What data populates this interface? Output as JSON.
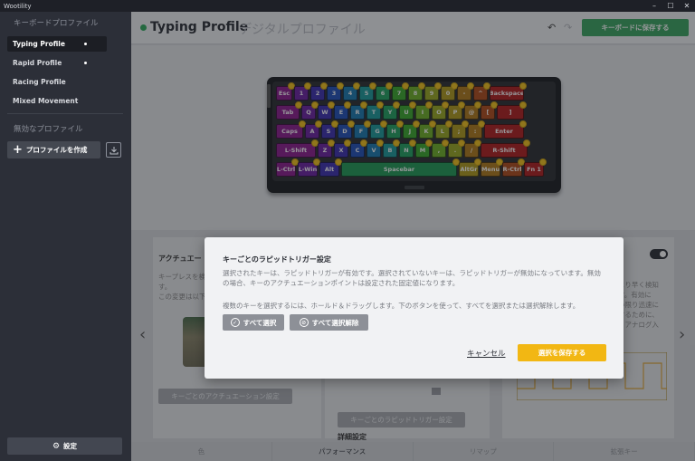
{
  "app": {
    "title": "Wootility"
  },
  "window_controls": {
    "minimize": "–",
    "maximize": "☐",
    "close": "✕"
  },
  "sidebar": {
    "heading_keyboard": "キーボードプロファイル",
    "items": [
      {
        "label": "Typing Profile",
        "active": true
      },
      {
        "label": "Rapid Profile",
        "active": false
      },
      {
        "label": "Racing Profile",
        "active": false
      },
      {
        "label": "Mixed Movement",
        "active": false
      }
    ],
    "heading_disabled": "無効なプロファイル",
    "create_label": "プロファイルを作成",
    "settings_label": "設定"
  },
  "header": {
    "title": "Typing Profile",
    "subtitle": "デジタルプロファイル",
    "save_label": "キーボードに保存する"
  },
  "keyboard": {
    "rows": [
      [
        {
          "label": "Esc",
          "w": 18,
          "c": "#8b1a8c"
        },
        {
          "label": "1",
          "w": 16,
          "c": "#6a1fa0"
        },
        {
          "label": "2",
          "w": 16,
          "c": "#3b2fb0"
        },
        {
          "label": "3",
          "w": 16,
          "c": "#1f4fb8"
        },
        {
          "label": "4",
          "w": 16,
          "c": "#1878b0"
        },
        {
          "label": "5",
          "w": 16,
          "c": "#1a9a9a"
        },
        {
          "label": "6",
          "w": 16,
          "c": "#1fa060"
        },
        {
          "label": "7",
          "w": 16,
          "c": "#3aa82a"
        },
        {
          "label": "8",
          "w": 16,
          "c": "#6db025"
        },
        {
          "label": "9",
          "w": 16,
          "c": "#9aa81f"
        },
        {
          "label": "0",
          "w": 16,
          "c": "#b09a1a"
        },
        {
          "label": "-",
          "w": 16,
          "c": "#b07818"
        },
        {
          "label": "^",
          "w": 16,
          "c": "#b04a18"
        },
        {
          "label": "Backspace",
          "w": 38,
          "c": "#b01c1c"
        }
      ],
      [
        {
          "label": "Tab",
          "w": 26,
          "c": "#8b1a8c"
        },
        {
          "label": "Q",
          "w": 16,
          "c": "#6a1fa0"
        },
        {
          "label": "W",
          "w": 16,
          "c": "#3b2fb0"
        },
        {
          "label": "E",
          "w": 16,
          "c": "#1f4fb8"
        },
        {
          "label": "R",
          "w": 16,
          "c": "#1878b0"
        },
        {
          "label": "T",
          "w": 16,
          "c": "#1a9a9a"
        },
        {
          "label": "Y",
          "w": 16,
          "c": "#1fa060"
        },
        {
          "label": "U",
          "w": 16,
          "c": "#3aa82a"
        },
        {
          "label": "I",
          "w": 16,
          "c": "#6db025"
        },
        {
          "label": "O",
          "w": 16,
          "c": "#9aa81f"
        },
        {
          "label": "P",
          "w": 16,
          "c": "#b09a1a"
        },
        {
          "label": "@",
          "w": 16,
          "c": "#b07818"
        },
        {
          "label": "[",
          "w": 16,
          "c": "#b04a18"
        },
        {
          "label": "]",
          "w": 30,
          "c": "#b01c1c"
        }
      ],
      [
        {
          "label": "Caps",
          "w": 30,
          "c": "#8b1a8c"
        },
        {
          "label": "A",
          "w": 16,
          "c": "#6a1fa0"
        },
        {
          "label": "S",
          "w": 16,
          "c": "#3b2fb0"
        },
        {
          "label": "D",
          "w": 16,
          "c": "#1f4fb8"
        },
        {
          "label": "F",
          "w": 16,
          "c": "#1878b0"
        },
        {
          "label": "G",
          "w": 16,
          "c": "#1a9a9a"
        },
        {
          "label": "H",
          "w": 16,
          "c": "#1fa060"
        },
        {
          "label": "J",
          "w": 16,
          "c": "#3aa82a"
        },
        {
          "label": "K",
          "w": 16,
          "c": "#6db025"
        },
        {
          "label": "L",
          "w": 16,
          "c": "#9aa81f"
        },
        {
          "label": ";",
          "w": 16,
          "c": "#b09a1a"
        },
        {
          "label": ":",
          "w": 16,
          "c": "#b07818"
        },
        {
          "label": "Enter",
          "w": 44,
          "c": "#b01c1c"
        }
      ],
      [
        {
          "label": "L-Shift",
          "w": 44,
          "c": "#8b1a8c"
        },
        {
          "label": "Z",
          "w": 16,
          "c": "#6a1fa0"
        },
        {
          "label": "X",
          "w": 16,
          "c": "#3b2fb0"
        },
        {
          "label": "C",
          "w": 16,
          "c": "#1f4fb8"
        },
        {
          "label": "V",
          "w": 16,
          "c": "#1878b0"
        },
        {
          "label": "B",
          "w": 16,
          "c": "#1a9a9a"
        },
        {
          "label": "N",
          "w": 16,
          "c": "#1fa060"
        },
        {
          "label": "M",
          "w": 16,
          "c": "#3aa82a"
        },
        {
          "label": ",",
          "w": 16,
          "c": "#6db025"
        },
        {
          "label": ".",
          "w": 16,
          "c": "#9aa81f"
        },
        {
          "label": "/",
          "w": 16,
          "c": "#b07818"
        },
        {
          "label": "R-Shift",
          "w": 52,
          "c": "#b01c1c"
        }
      ],
      [
        {
          "label": "L-Ctrl",
          "w": 22,
          "c": "#8b1a8c"
        },
        {
          "label": "L-Win",
          "w": 22,
          "c": "#6a1fa0"
        },
        {
          "label": "Alt",
          "w": 22,
          "c": "#3b2fb0"
        },
        {
          "label": "Spacebar",
          "w": 128,
          "c": "#1f9a55"
        },
        {
          "label": "AltGr",
          "w": 22,
          "c": "#b09a1a"
        },
        {
          "label": "Menu",
          "w": 22,
          "c": "#b07818"
        },
        {
          "label": "R-Ctrl",
          "w": 22,
          "c": "#b04a18"
        },
        {
          "label": "Fn 1",
          "w": 22,
          "c": "#b01c1c"
        }
      ]
    ]
  },
  "panels": {
    "actuation": {
      "title": "アクチュエー",
      "text_line1": "キープレスを検",
      "text_line2": "す。",
      "text_line3": "この変更は以下",
      "button": "キーごとのアクチュエーション設定"
    },
    "rapid_trigger": {
      "button": "キーごとのラピッドトリガー設定",
      "detail": "詳細設定"
    },
    "analog": {
      "text_line1": "より早く検知",
      "text_line2": "す。有効に",
      "text_line3": "い限り迅速に",
      "text_line4": "するために、",
      "text_line5": "、アナログ入"
    }
  },
  "tabs": [
    {
      "label": "色",
      "active": false
    },
    {
      "label": "パフォーマンス",
      "active": true
    },
    {
      "label": "リマップ",
      "active": false
    },
    {
      "label": "拡張キー",
      "active": false
    }
  ],
  "modal": {
    "title": "キーごとのラピッドトリガー設定",
    "description": "選択されたキーは、ラピッドトリガーが有効です。選択されていないキーは、ラピッドトリガーが無効になっています。無効の場合、キーのアクチュエーションポイントは設定された固定値になります。",
    "hint": "複数のキーを選択するには、ホールド＆ドラッグします。下のボタンを使って、すべてを選択または選択解除します。",
    "select_all": "すべて選択",
    "deselect_all": "すべて選択解除",
    "cancel": "キャンセル",
    "save": "選択を保存する"
  }
}
